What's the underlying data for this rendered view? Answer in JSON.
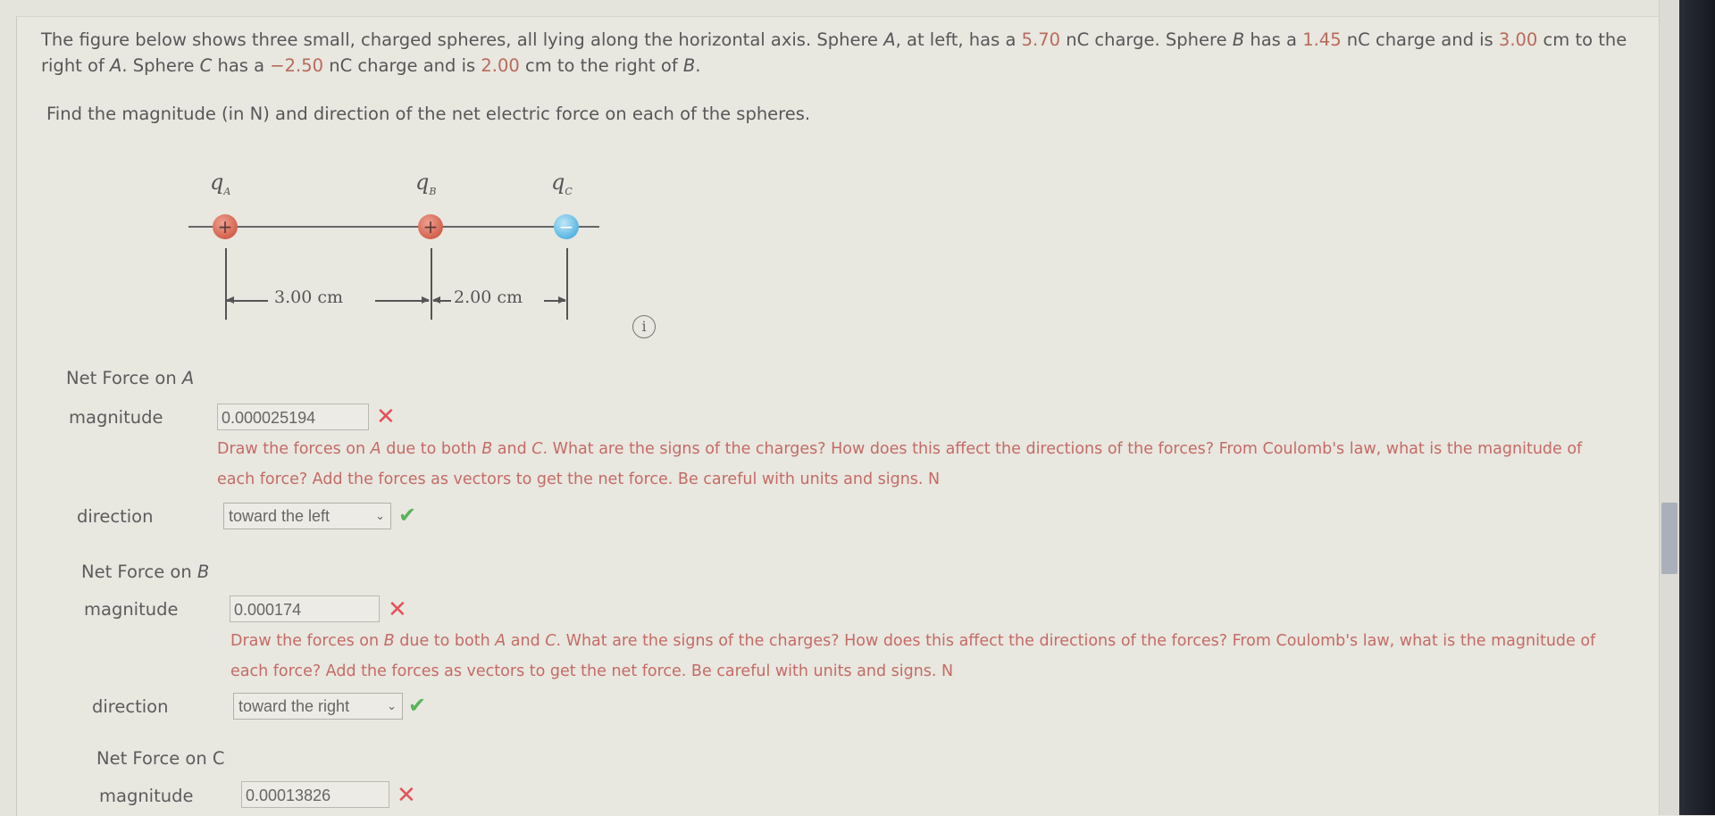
{
  "problem": {
    "line1_a": "The figure below shows three small, charged spheres, all lying along the horizontal axis. Sphere ",
    "A": "A",
    "line1_b": ", at left, has a ",
    "qA": "5.70",
    "line1_c": " nC charge. Sphere ",
    "B": "B",
    "line1_d": " has a ",
    "qB": "1.45",
    "line1_e": " nC charge and is ",
    "dAB": "3.00",
    "line1_f": " cm to the right of ",
    "line1_g": ". Sphere ",
    "C": "C",
    "line1_h": " has a ",
    "qC": "−2.50",
    "line1_i": " nC charge and is ",
    "dBC": "2.00",
    "line1_j": " cm to the right of ",
    "end": ".",
    "find": "Find the magnitude (in N) and direction of the net electric force on each of the spheres."
  },
  "figure": {
    "q_label": "q",
    "sub_A": "A",
    "sub_B": "B",
    "sub_C": "C",
    "sign_A": "+",
    "sign_B": "+",
    "sign_C": "−",
    "dist_AB": "3.00 cm",
    "dist_BC": "2.00 cm",
    "info_icon": "i"
  },
  "sections": [
    {
      "title": "Net Force on ",
      "title_var": "A",
      "magnitude_label": "magnitude",
      "magnitude_value": "0.000025194",
      "magnitude_status": "incorrect",
      "hint_1": "Draw the forces on ",
      "hint_v1": "A",
      "hint_2": " due to both ",
      "hint_v2": "B",
      "hint_3": " and ",
      "hint_v3": "C",
      "hint_4": ". What are the signs of the charges? How does this affect the directions of the forces? From Coulomb's law, what is the magnitude of each force? Add the forces as vectors to get the net force. Be careful with units and signs. N",
      "direction_label": "direction",
      "direction_value": "toward the left",
      "direction_status": "correct"
    },
    {
      "title": "Net Force on ",
      "title_var": "B",
      "magnitude_label": "magnitude",
      "magnitude_value": "0.000174",
      "magnitude_status": "incorrect",
      "hint_1": "Draw the forces on ",
      "hint_v1": "B",
      "hint_2": " due to both ",
      "hint_v2": "A",
      "hint_3": " and ",
      "hint_v3": "C",
      "hint_4": ". What are the signs of the charges? How does this affect the directions of the forces? From Coulomb's law, what is the magnitude of each force? Add the forces as vectors to get the net force. Be careful with units and signs. N",
      "direction_label": "direction",
      "direction_value": "toward the right",
      "direction_status": "correct"
    },
    {
      "title": "Net Force on C",
      "magnitude_label": "magnitude",
      "magnitude_value": "0.00013826",
      "magnitude_status": "incorrect"
    }
  ],
  "status_icons": {
    "wrong": "✕",
    "right": "✔"
  },
  "colors": {
    "incorrect": "#e1535b",
    "correct": "#59b35a",
    "hint": "#c46b66",
    "highlight": "#b86a5a"
  }
}
